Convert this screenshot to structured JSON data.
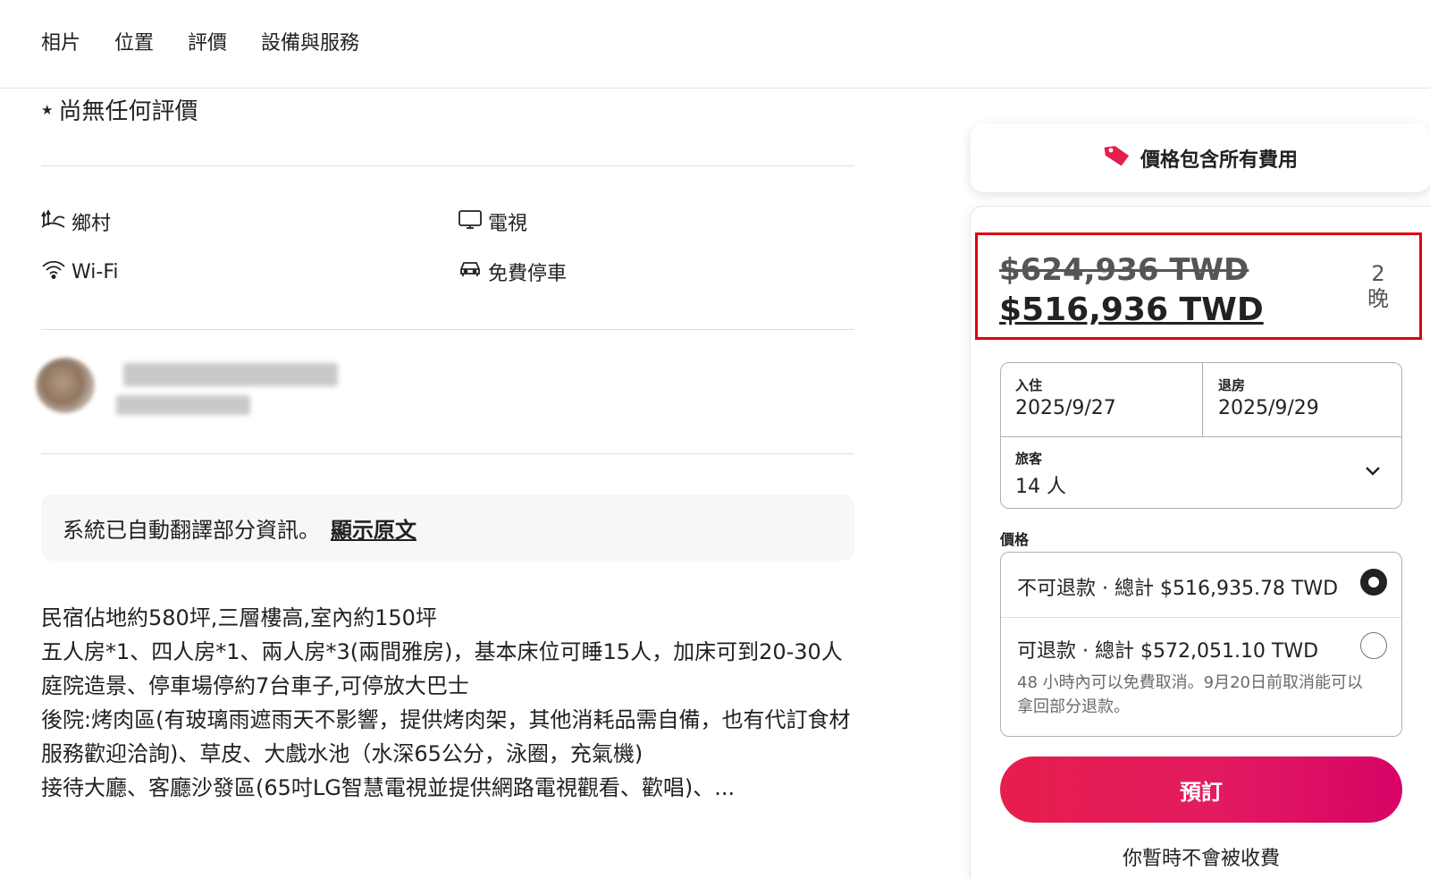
{
  "nav": {
    "items": [
      "相片",
      "位置",
      "評價",
      "設備與服務"
    ]
  },
  "reviews": {
    "star": "★",
    "text": "尚無任何評價"
  },
  "amenities": [
    {
      "icon": "countryside-icon",
      "label": "鄉村"
    },
    {
      "icon": "tv-icon",
      "label": "電視"
    },
    {
      "icon": "wifi-icon",
      "label": "Wi-Fi"
    },
    {
      "icon": "car-icon",
      "label": "免費停車"
    }
  ],
  "translation": {
    "text": "系統已自動翻譯部分資訊。",
    "link": "顯示原文"
  },
  "description": [
    "民宿佔地約580坪,三層樓高,室內約150坪",
    "五人房*1、四人房*1、兩人房*3(兩間雅房)，基本床位可睡15人，加床可到20-30人",
    "庭院造景、停車場停約7台車子,可停放大巴士",
    "後院:烤肉區(有玻璃雨遮雨天不影響，提供烤肉架，其他消耗品需自備，也有代訂食材服務歡迎洽詢)、草皮、大戲水池（水深65公分，泳圈，充氣機)",
    "接待大廳、客廳沙發區(65吋LG智慧電視並提供網路電視觀看、歡唱)、..."
  ],
  "fee_banner": {
    "icon": "price-tag-icon",
    "text": "價格包含所有費用"
  },
  "pricing": {
    "original": "$624,936 TWD",
    "current": "$516,936 TWD",
    "nights_count": "2",
    "nights_unit": "晚"
  },
  "booking": {
    "checkin_label": "入住",
    "checkin_value": "2025/9/27",
    "checkout_label": "退房",
    "checkout_value": "2025/9/29",
    "guests_label": "旅客",
    "guests_value": "14 人",
    "price_label": "價格",
    "option_nonrefundable": "不可退款 · 總計 $516,935.78 TWD",
    "option_refundable": "可退款 · 總計 $572,051.10 TWD",
    "refund_note": "48 小時內可以免費取消。9月20日前取消能可以拿回部分退款。",
    "selected_option": "nonrefundable",
    "reserve_label": "預訂",
    "no_charge": "你暫時不會被收費"
  },
  "colors": {
    "accent": "#e31c5f",
    "highlight_box": "#e0000f"
  }
}
